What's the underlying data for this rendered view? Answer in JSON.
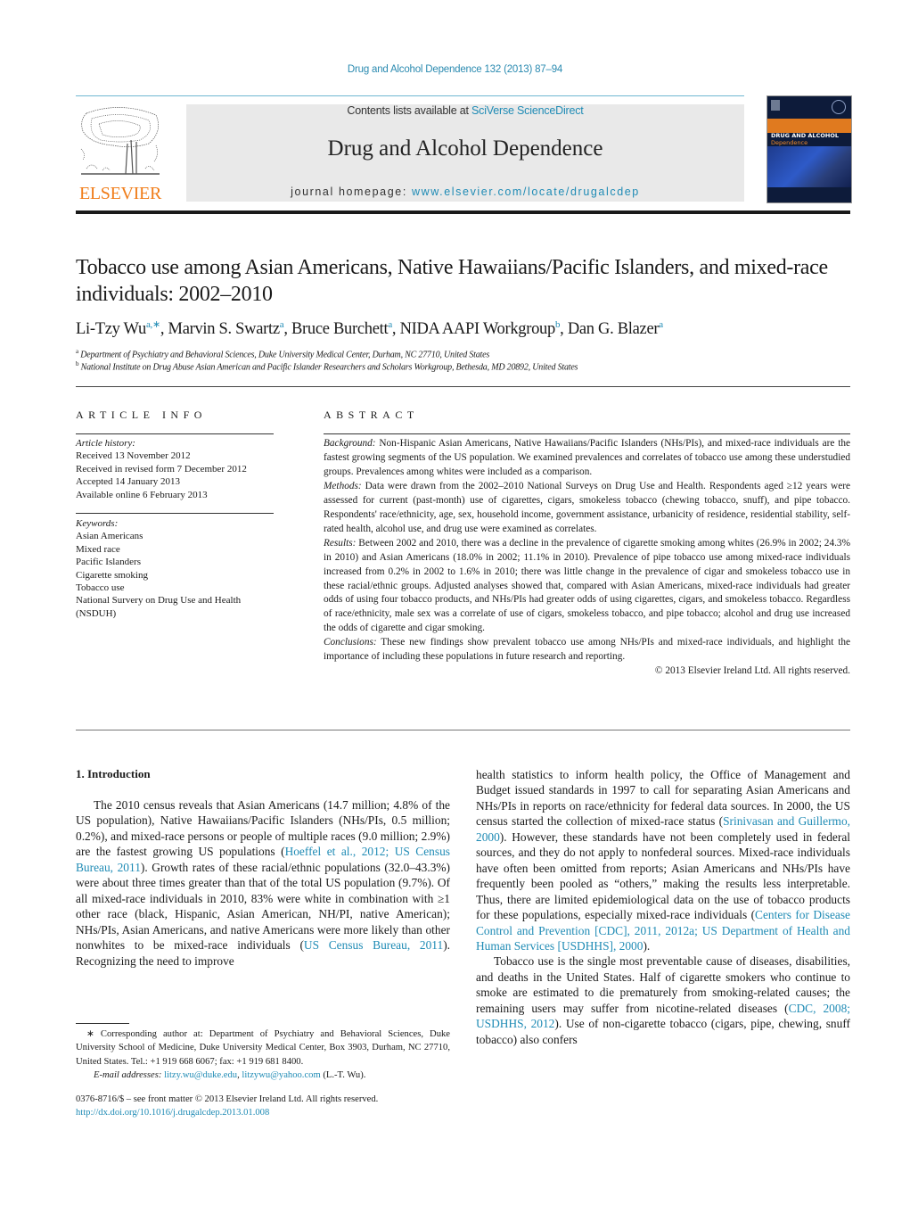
{
  "header": {
    "journal_ref": "Drug and Alcohol Dependence 132 (2013) 87–94",
    "publisher_wordmark": "ELSEVIER",
    "contents_prefix": "Contents lists available at ",
    "contents_link": "SciVerse ScienceDirect",
    "journal_title": "Drug and Alcohol Dependence",
    "homepage_prefix": "journal homepage: ",
    "homepage_link": "www.elsevier.com/locate/drugalcdep",
    "cover": {
      "title": "DRUG AND ALCOHOL",
      "subtitle": "Dependence"
    },
    "colors": {
      "link": "#1f8bb5",
      "elsevier_orange": "#f07d1a",
      "masthead_bg": "#e9e9e9"
    }
  },
  "article": {
    "title": "Tobacco use among Asian Americans, Native Hawaiians/Pacific Islanders, and mixed-race individuals: 2002–2010",
    "authors": [
      {
        "name": "Li-Tzy Wu",
        "sup": "a,∗",
        "sep": ", "
      },
      {
        "name": "Marvin S. Swartz",
        "sup": "a",
        "sep": ", "
      },
      {
        "name": "Bruce Burchett",
        "sup": "a",
        "sep": ", "
      },
      {
        "name": "NIDA AAPI Workgroup",
        "sup": "b",
        "sep": ", "
      },
      {
        "name": "Dan G. Blazer",
        "sup": "a",
        "sep": ""
      }
    ],
    "affiliations": [
      {
        "mark": "a",
        "text": "Department of Psychiatry and Behavioral Sciences, Duke University Medical Center, Durham, NC 27710, United States"
      },
      {
        "mark": "b",
        "text": "National Institute on Drug Abuse Asian American and Pacific Islander Researchers and Scholars Workgroup, Bethesda, MD 20892, United States"
      }
    ]
  },
  "article_info": {
    "heading": "ARTICLE INFO",
    "history_label": "Article history:",
    "history": [
      "Received 13 November 2012",
      "Received in revised form 7 December 2012",
      "Accepted 14 January 2013",
      "Available online 6 February 2013"
    ],
    "keywords_label": "Keywords:",
    "keywords": [
      "Asian Americans",
      "Mixed race",
      "Pacific Islanders",
      "Cigarette smoking",
      "Tobacco use",
      "National Survery on Drug Use and Health",
      "(NSDUH)"
    ]
  },
  "abstract": {
    "heading": "ABSTRACT",
    "background_label": "Background:",
    "background": "Non-Hispanic Asian Americans, Native Hawaiians/Pacific Islanders (NHs/PIs), and mixed-race individuals are the fastest growing segments of the US population. We examined prevalences and correlates of tobacco use among these understudied groups. Prevalences among whites were included as a comparison.",
    "methods_label": "Methods:",
    "methods": "Data were drawn from the 2002–2010 National Surveys on Drug Use and Health. Respondents aged ≥12 years were assessed for current (past-month) use of cigarettes, cigars, smokeless tobacco (chewing tobacco, snuff), and pipe tobacco. Respondents' race/ethnicity, age, sex, household income, government assistance, urbanicity of residence, residential stability, self-rated health, alcohol use, and drug use were examined as correlates.",
    "results_label": "Results:",
    "results": "Between 2002 and 2010, there was a decline in the prevalence of cigarette smoking among whites (26.9% in 2002; 24.3% in 2010) and Asian Americans (18.0% in 2002; 11.1% in 2010). Prevalence of pipe tobacco use among mixed-race individuals increased from 0.2% in 2002 to 1.6% in 2010; there was little change in the prevalence of cigar and smokeless tobacco use in these racial/ethnic groups. Adjusted analyses showed that, compared with Asian Americans, mixed-race individuals had greater odds of using four tobacco products, and NHs/PIs had greater odds of using cigarettes, cigars, and smokeless tobacco. Regardless of race/ethnicity, male sex was a correlate of use of cigars, smokeless tobacco, and pipe tobacco; alcohol and drug use increased the odds of cigarette and cigar smoking.",
    "conclusions_label": "Conclusions:",
    "conclusions": "These new findings show prevalent tobacco use among NHs/PIs and mixed-race individuals, and highlight the importance of including these populations in future research and reporting.",
    "copyright": "© 2013 Elsevier Ireland Ltd. All rights reserved."
  },
  "body": {
    "intro_heading": "1.  Introduction",
    "left_p1": [
      {
        "t": "The 2010 census reveals that Asian Americans (14.7 million; 4.8% of the US population), Native Hawaiians/Pacific Islanders (NHs/PIs, 0.5 million; 0.2%), and mixed-race persons or people of multiple races (9.0 million; 2.9%) are the fastest growing US populations ("
      },
      {
        "t": "Hoeffel et al., 2012; US Census Bureau, 2011",
        "link": true
      },
      {
        "t": "). Growth rates of these racial/ethnic populations (32.0–43.3%) were about three times greater than that of the total US population (9.7%). Of all mixed-race individuals in 2010, 83% were white in combination with ≥1 other race (black, Hispanic, Asian American, NH/PI, native American); NHs/PIs, Asian Americans, and native Americans were more likely than other nonwhites to be mixed-race individuals ("
      },
      {
        "t": "US Census Bureau, 2011",
        "link": true
      },
      {
        "t": "). Recognizing the need to improve"
      }
    ],
    "right_p1": [
      {
        "t": "health statistics to inform health policy, the Office of Management and Budget issued standards in 1997 to call for separating Asian Americans and NHs/PIs in reports on race/ethnicity for federal data sources. In 2000, the US census started the collection of mixed-race status ("
      },
      {
        "t": "Srinivasan and Guillermo, 2000",
        "link": true
      },
      {
        "t": "). However, these standards have not been completely used in federal sources, and they do not apply to nonfederal sources. Mixed-race individuals have often been omitted from reports; Asian Americans and NHs/PIs have frequently been pooled as “others,” making the results less interpretable. Thus, there are limited epidemiological data on the use of tobacco products for these populations, especially mixed-race individuals ("
      },
      {
        "t": "Centers for Disease Control and Prevention [CDC], 2011, 2012a; US Department of Health and Human Services [USDHHS], 2000",
        "link": true
      },
      {
        "t": ")."
      }
    ],
    "right_p2": [
      {
        "t": "Tobacco use is the single most preventable cause of diseases, disabilities, and deaths in the United States. Half of cigarette smokers who continue to smoke are estimated to die prematurely from smoking-related causes; the remaining users may suffer from nicotine-related diseases ("
      },
      {
        "t": "CDC, 2008; USDHHS, 2012",
        "link": true
      },
      {
        "t": "). Use of non-cigarette tobacco (cigars, pipe, chewing, snuff tobacco) also confers"
      }
    ]
  },
  "footnote": {
    "corresponding": "∗ Corresponding author at: Department of Psychiatry and Behavioral Sciences, Duke University School of Medicine, Duke University Medical Center, Box 3903, Durham, NC 27710, United States. Tel.: +1 919 668 6067; fax: +1 919 681 8400.",
    "email_label": "E-mail addresses:",
    "email_1": "litzy.wu@duke.edu",
    "email_2": "litzywu@yahoo.com",
    "email_suffix": " (L.-T. Wu).",
    "issn_line": "0376-8716/$ – see front matter © 2013 Elsevier Ireland Ltd. All rights reserved.",
    "doi": "http://dx.doi.org/10.1016/j.drugalcdep.2013.01.008"
  }
}
